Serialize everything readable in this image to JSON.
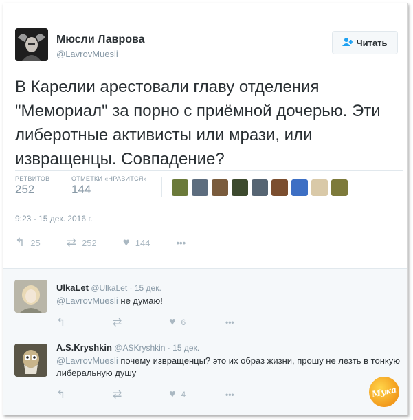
{
  "tweet": {
    "author_name": "Мюсли Лаврова",
    "author_handle": "@LavrovMuesli",
    "follow_label": "Читать",
    "text": "В Карелии арестовали главу отделения \"Мемориал\" за порно с приёмной дочерью. Эти либеротные активисты или мрази, или извращенцы. Совпадение?",
    "retweets_label": "РЕТВИТОВ",
    "retweets_count": "252",
    "likes_label": "ОТМЕТКИ «НРАВИТСЯ»",
    "likes_count": "144",
    "timestamp": "9:23 - 15 дек. 2016 г.",
    "actions": {
      "replies": "25",
      "retweets": "252",
      "likes": "144",
      "more": "•••"
    }
  },
  "likers_colors": [
    "#6b7a3a",
    "#5d6d7e",
    "#7a5c3d",
    "#3d4a2e",
    "#566573",
    "#7b4e2f",
    "#3d6fc4",
    "#d9c9a8",
    "#7d7a3a"
  ],
  "replies": [
    {
      "name": "UlkaLet",
      "handle": "@UlkaLet",
      "date": "· 15 дек.",
      "mention": "@LavrovMuesli",
      "text": " не думаю!",
      "likes": "6",
      "more": "•••"
    },
    {
      "name": "A.S.Kryshkin",
      "handle": "@ASKryshkin",
      "date": "· 15 дек.",
      "mention": "@LavrovMuesli",
      "text": " почему извращенцы? это их образ жизни, прошу не лезть в тонкую либеральную душу",
      "likes": "4",
      "more": "•••"
    }
  ],
  "watermark": "Мука"
}
